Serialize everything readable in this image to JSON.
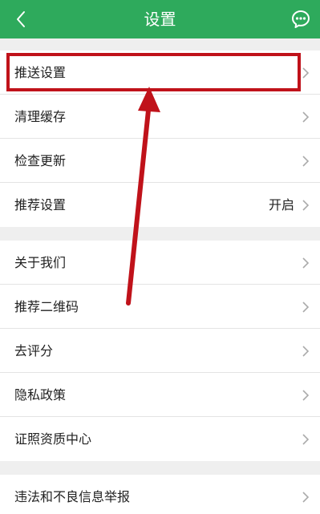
{
  "header": {
    "title": "设置",
    "back_icon": "chevron-left-icon",
    "more_icon": "chat-bubble-dots-icon",
    "background": "#2eaa5c"
  },
  "sections": [
    {
      "items": [
        {
          "label": "推送设置",
          "value": ""
        },
        {
          "label": "清理缓存",
          "value": ""
        },
        {
          "label": "检查更新",
          "value": ""
        },
        {
          "label": "推荐设置",
          "value": "开启"
        }
      ]
    },
    {
      "items": [
        {
          "label": "关于我们",
          "value": ""
        },
        {
          "label": "推荐二维码",
          "value": ""
        },
        {
          "label": "去评分",
          "value": ""
        },
        {
          "label": "隐私政策",
          "value": ""
        },
        {
          "label": "证照资质中心",
          "value": ""
        }
      ]
    },
    {
      "items": [
        {
          "label": "违法和不良信息举报",
          "value": ""
        }
      ]
    }
  ],
  "annotation": {
    "color": "#c0121a",
    "highlighted_item": "推送设置"
  }
}
